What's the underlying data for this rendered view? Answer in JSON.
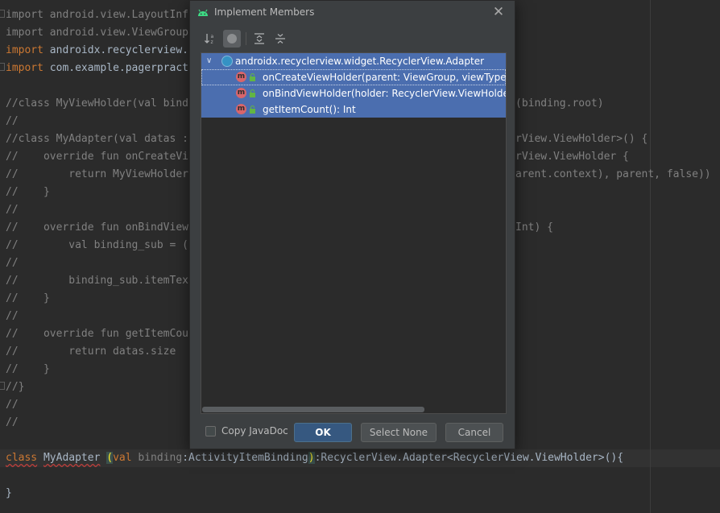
{
  "editor": {
    "lines": [
      {
        "prefix": "import ",
        "rest": "android.view.LayoutInf",
        "kind": "import-dim"
      },
      {
        "prefix": "import ",
        "rest": "android.view.ViewGroup",
        "kind": "import-dim"
      },
      {
        "prefix": "import ",
        "rest": "androidx.recyclerview.",
        "kind": "import"
      },
      {
        "prefix": "import ",
        "rest": "com.example.pagerpract",
        "kind": "import"
      },
      {
        "text": "",
        "kind": "blank"
      },
      {
        "text": "//class MyViewHolder(val bind",
        "right": "(binding.root)",
        "kind": "comment"
      },
      {
        "text": "//",
        "kind": "comment"
      },
      {
        "text": "//class MyAdapter(val datas :",
        "right": "rView.ViewHolder>() {",
        "kind": "comment"
      },
      {
        "text": "//    override fun onCreateVi",
        "right": "rView.ViewHolder {",
        "kind": "comment"
      },
      {
        "text": "//        return MyViewHolder",
        "right": "arent.context), parent, false))",
        "kind": "comment"
      },
      {
        "text": "//    }",
        "kind": "comment"
      },
      {
        "text": "//",
        "kind": "comment"
      },
      {
        "text": "//    override fun onBindView",
        "right": "Int) {",
        "kind": "comment"
      },
      {
        "text": "//        val binding_sub = (",
        "kind": "comment"
      },
      {
        "text": "//",
        "kind": "comment"
      },
      {
        "text": "//        binding_sub.itemTex",
        "kind": "comment"
      },
      {
        "text": "//    }",
        "kind": "comment"
      },
      {
        "text": "//",
        "kind": "comment"
      },
      {
        "text": "//    override fun getItemCou",
        "kind": "comment"
      },
      {
        "text": "//        return datas.size",
        "kind": "comment"
      },
      {
        "text": "//    }",
        "kind": "comment"
      },
      {
        "text": "//}",
        "kind": "comment"
      },
      {
        "text": "//",
        "kind": "comment"
      },
      {
        "text": "//",
        "kind": "comment"
      },
      {
        "text": "",
        "kind": "blank"
      },
      {
        "kind": "class-decl"
      },
      {
        "text": "",
        "kind": "blank"
      },
      {
        "text": "}",
        "kind": "plain"
      }
    ],
    "class_decl": {
      "kw_class": "class",
      "name": "MyAdapter",
      "space": " ",
      "open_paren": "(",
      "kw_val": "val",
      "param": " binding",
      "type": ":ActivityItemBinding",
      "close_paren": ")",
      "rest": ":RecyclerView.Adapter<RecyclerView.ViewHolder>(){"
    }
  },
  "dialog": {
    "title": "Implement Members",
    "close_label": "✕",
    "tree": {
      "root_label": "androidx.recyclerview.widget.RecyclerView.Adapter",
      "members": [
        "onCreateViewHolder(parent: ViewGroup, viewType: Int): RecyclerView.ViewHolder",
        "onBindViewHolder(holder: RecyclerView.ViewHolder, position: Int): Unit",
        "getItemCount(): Int"
      ],
      "method_badge": "m"
    },
    "copy_javadoc_label": "Copy JavaDoc",
    "ok_label": "OK",
    "select_none_label": "Select None",
    "cancel_label": "Cancel"
  },
  "colors": {
    "editor_bg": "#2b2b2b",
    "dialog_bg": "#3c3f41",
    "selection": "#4b6eaf",
    "ok_button": "#365880",
    "comment": "#808080",
    "keyword": "#cc7832"
  }
}
